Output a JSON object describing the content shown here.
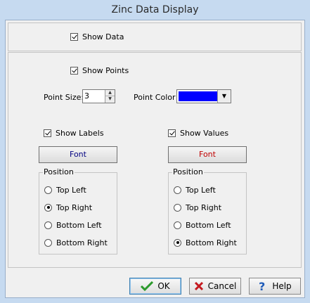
{
  "window": {
    "title": "Zinc Data Display"
  },
  "show_data": {
    "label": "Show Data",
    "checked": true
  },
  "show_points": {
    "label": "Show Points",
    "checked": true
  },
  "point_size": {
    "label": "Point Size:",
    "value": "3"
  },
  "point_color": {
    "label": "Point Color",
    "color": "#0000ff"
  },
  "labels": {
    "show_label": "Show Labels",
    "checked": true,
    "font_button": "Font",
    "font_color": "#000080",
    "position": {
      "title": "Position",
      "options": [
        "Top Left",
        "Top Right",
        "Bottom Left",
        "Bottom Right"
      ],
      "selected": "Top Right"
    }
  },
  "values": {
    "show_label": "Show Values",
    "checked": true,
    "font_button": "Font",
    "font_color": "#c00000",
    "position": {
      "title": "Position",
      "options": [
        "Top Left",
        "Top Right",
        "Bottom Left",
        "Bottom Right"
      ],
      "selected": "Bottom Right"
    }
  },
  "footer": {
    "ok": "OK",
    "cancel": "Cancel",
    "help": "Help"
  }
}
